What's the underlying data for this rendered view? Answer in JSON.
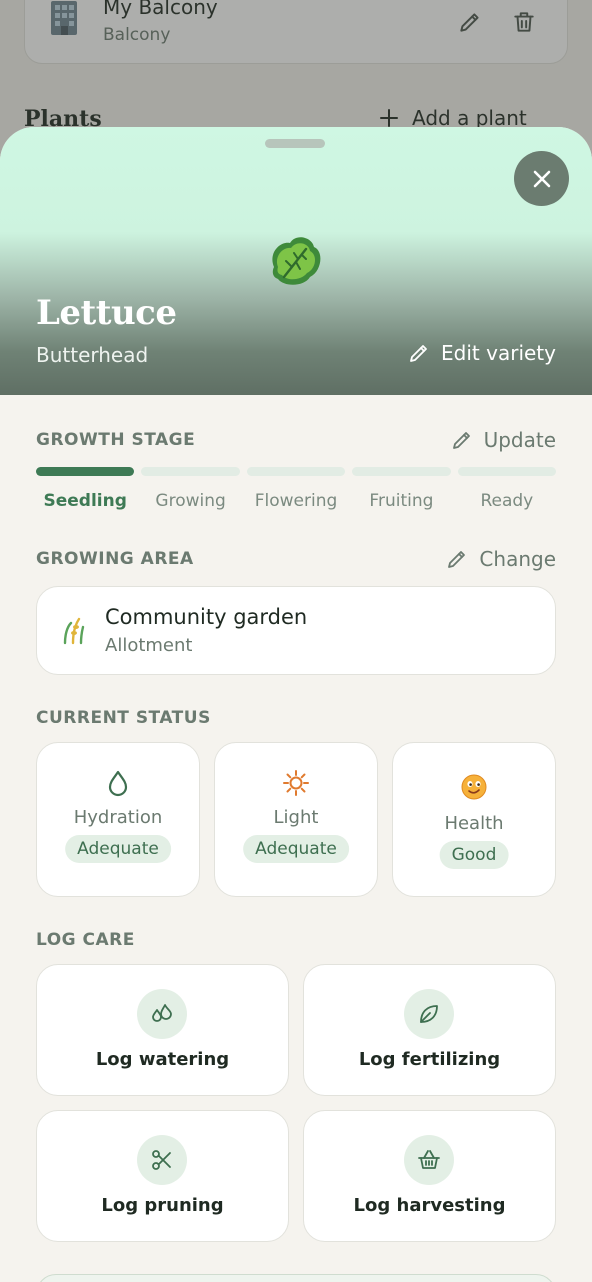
{
  "background": {
    "garden_card": {
      "title": "My Balcony",
      "subtitle": "Balcony"
    },
    "plants_heading": "Plants",
    "add_plant_label": "Add a plant"
  },
  "sheet": {
    "plant_name": "Lettuce",
    "variety": "Butterhead",
    "edit_variety_label": "Edit variety",
    "growth_stage": {
      "label": "GROWTH STAGE",
      "action": "Update",
      "stages": [
        "Seedling",
        "Growing",
        "Flowering",
        "Fruiting",
        "Ready"
      ],
      "current_index": 0
    },
    "growing_area": {
      "label": "GROWING AREA",
      "action": "Change",
      "name": "Community garden",
      "type": "Allotment"
    },
    "current_status": {
      "label": "CURRENT STATUS",
      "items": [
        {
          "name": "Hydration",
          "value": "Adequate",
          "icon": "water-drop-icon"
        },
        {
          "name": "Light",
          "value": "Adequate",
          "icon": "sun-icon"
        },
        {
          "name": "Health",
          "value": "Good",
          "icon": "smiley-face-icon"
        }
      ]
    },
    "log_care": {
      "label": "LOG CARE",
      "actions": [
        {
          "label": "Log watering",
          "icon": "droplets-icon"
        },
        {
          "label": "Log fertilizing",
          "icon": "leaf-icon"
        },
        {
          "label": "Log pruning",
          "icon": "scissors-icon"
        },
        {
          "label": "Log harvesting",
          "icon": "basket-icon"
        }
      ]
    }
  },
  "colors": {
    "accent": "#3e7a55",
    "muted_text": "#6b7a70",
    "pill_bg": "#e3efe5",
    "hero_top": "#cff7e3",
    "hero_bottom": "#5f6f64",
    "sun": "#e07a2e"
  }
}
